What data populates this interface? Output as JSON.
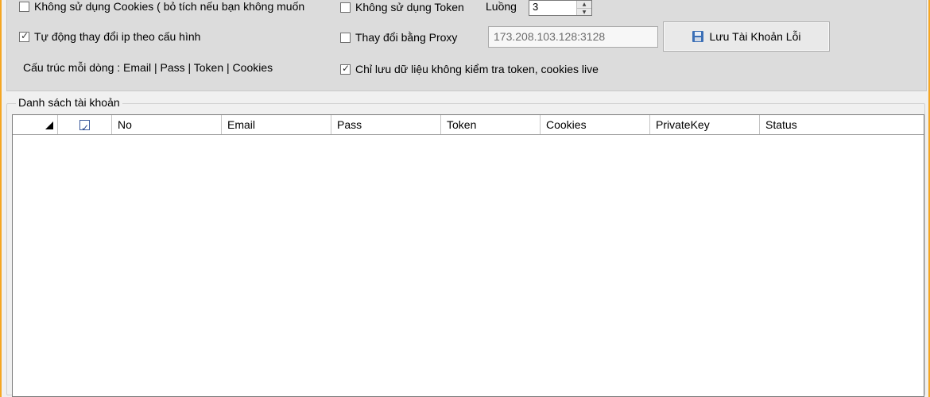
{
  "options": {
    "no_cookies_label": "Không sử dụng Cookies ( bỏ tích nếu bạn không muốn",
    "no_cookies_checked": false,
    "no_token_label": "Không sử dụng Token",
    "no_token_checked": false,
    "threads_label": "Luồng",
    "threads_value": "3",
    "auto_ip_label": "Tự động thay đổi ip theo cấu hình",
    "auto_ip_checked": true,
    "proxy_label": "Thay đổi bằng Proxy",
    "proxy_checked": false,
    "proxy_value": "173.208.103.128:3128",
    "save_button_label": "Lưu Tài Khoản Lỗi",
    "line_format_label": "Cấu trúc mỗi dòng : Email | Pass | Token | Cookies",
    "save_only_label": "Chỉ lưu dữ liệu không kiểm tra token, cookies live",
    "save_only_checked": true
  },
  "accounts": {
    "group_title": "Danh sách tài khoản",
    "select_all_checked": true,
    "columns": [
      "No",
      "Email",
      "Pass",
      "Token",
      "Cookies",
      "PrivateKey",
      "Status"
    ],
    "rows": []
  },
  "colors": {
    "window_border": "#f5a623",
    "panel_bg": "#dcdcdc",
    "form_bg": "#f0f0f0",
    "checkbox_accent": "#2b4a8f"
  },
  "icons": {
    "save_button_icon": "floppy-disk-icon",
    "sort_corner_icon": "select-all-triangle-icon",
    "spinner_up_icon": "spinner-up-arrow-icon",
    "spinner_down_icon": "spinner-down-arrow-icon"
  }
}
